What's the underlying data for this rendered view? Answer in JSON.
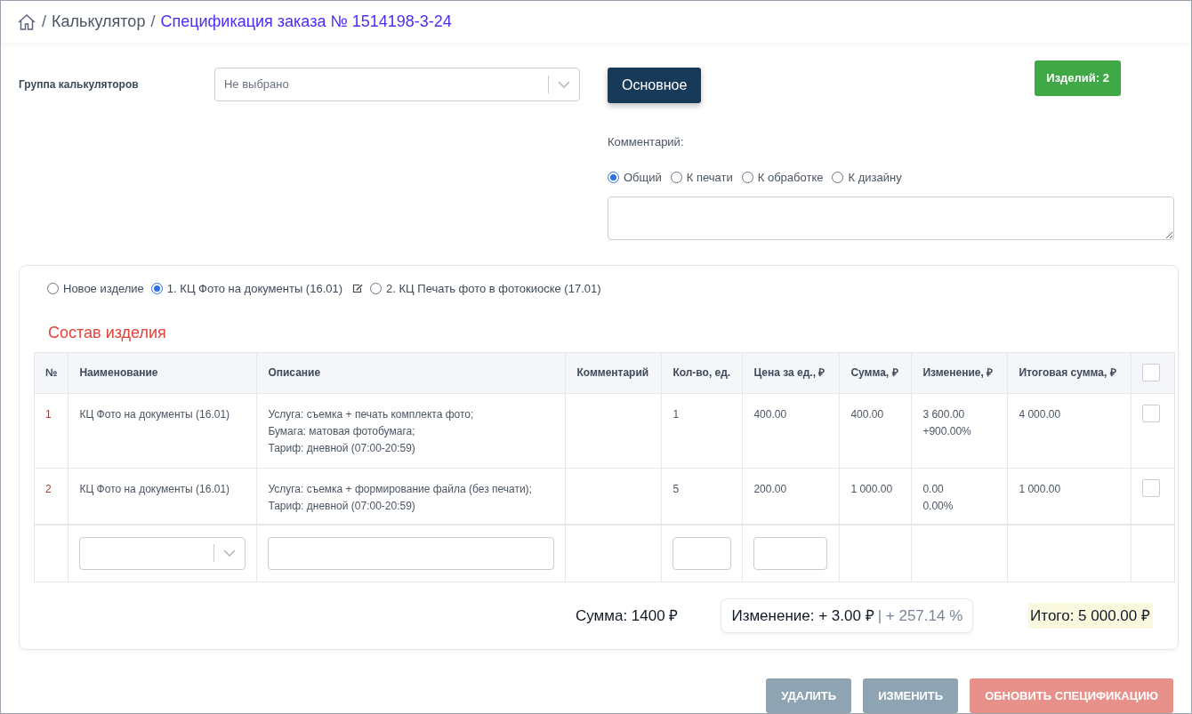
{
  "breadcrumb_separator": "/",
  "breadcrumb": [
    {
      "label": "Калькулятор",
      "current": false
    },
    {
      "label": "Спецификация заказа № 1514198-3-24",
      "current": true
    }
  ],
  "calculator_group": {
    "label": "Группа калькуляторов",
    "placeholder": "Не выбрано"
  },
  "main_button": "Основное",
  "items_badge": "Изделий: 2",
  "comment": {
    "label": "Комментарий:",
    "types": [
      {
        "label": "Общий",
        "selected": true
      },
      {
        "label": "К печати",
        "selected": false
      },
      {
        "label": "К обработке",
        "selected": false
      },
      {
        "label": "К дизайну",
        "selected": false
      }
    ]
  },
  "products": [
    {
      "label": "Новое изделие",
      "selected": false,
      "editable": false
    },
    {
      "label": "1. КЦ Фото на документы (16.01)",
      "selected": true,
      "editable": true
    },
    {
      "label": "2. КЦ Печать фото в фотокиоске (17.01)",
      "selected": false,
      "editable": false
    }
  ],
  "section_title": "Состав изделия",
  "table": {
    "columns": [
      "№",
      "Наименование",
      "Описание",
      "Комментарий",
      "Кол-во, ед.",
      "Цена за ед., ₽",
      "Сумма, ₽",
      "Изменение, ₽",
      "Итоговая сумма, ₽"
    ],
    "select_all_checked": false,
    "rows": [
      {
        "number": "1",
        "name": "КЦ Фото на документы (16.01)",
        "description": [
          "Услуга: съемка + печать комплекта фото;",
          "Бумага: матовая фотобумага;",
          "Тариф: дневной (07:00-20:59)"
        ],
        "quantity": "1",
        "price": "400.00",
        "sum": "400.00",
        "change": [
          "3 600.00",
          "+900.00%"
        ],
        "total": "4 000.00",
        "checked": false
      },
      {
        "number": "2",
        "name": "КЦ Фото на документы (16.01)",
        "description": [
          "Услуга: съемка + формирование файла (без печати);",
          "Тариф: дневной (07:00-20:59)"
        ],
        "quantity": "5",
        "price": "200.00",
        "sum": "1 000.00",
        "change": [
          "0.00",
          "0.00%"
        ],
        "total": "1 000.00",
        "checked": false
      }
    ]
  },
  "summary": {
    "sum": "Сумма: 1400 ₽",
    "change": "Изменение: + 3.00 ₽",
    "change_percent": "| + 257.14 %",
    "total": "Итого: 5 000.00 ₽"
  },
  "actions": [
    {
      "label": "УДАЛИТЬ",
      "kind": "secondary"
    },
    {
      "label": "ИЗМЕНИТЬ",
      "kind": "secondary"
    },
    {
      "label": "ОБНОВИТЬ СПЕЦИФИКАЦИЮ",
      "kind": "danger"
    }
  ]
}
